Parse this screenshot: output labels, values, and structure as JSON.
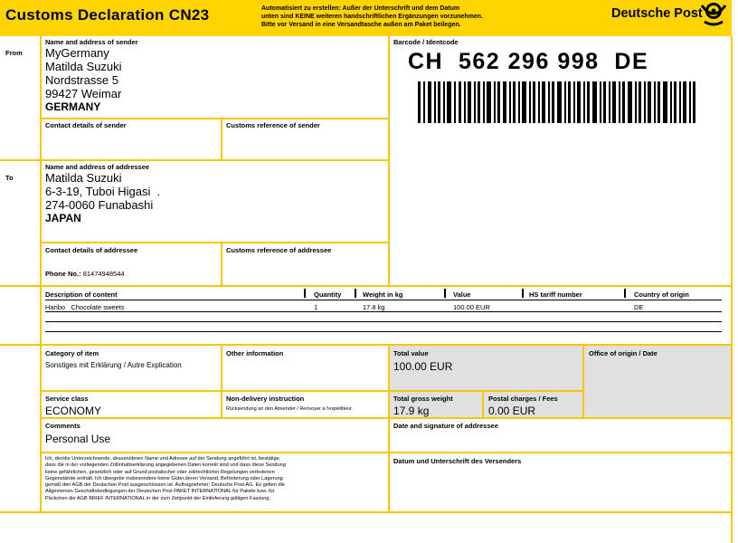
{
  "header": {
    "title": "Customs Declaration CN23",
    "instructions": [
      "Automatisiert zu erstellen: Außer der Unterschrift und dem Datum",
      "unten sind KEINE weiteren handschriftlichen Ergänzungen vorzunehmen.",
      "Bitte vor Versand in eine Versandtasche außen am Paket beilegen."
    ],
    "brand": "Deutsche Post"
  },
  "sender": {
    "row_label": "From",
    "label": "Name and address of sender",
    "lines": [
      "MyGermany",
      "Matilda Suzuki",
      "Nordstrasse 5",
      "99427 Weimar"
    ],
    "country": "GERMANY",
    "contact_label": "Contact details of sender",
    "reference_label": "Customs reference of sender"
  },
  "barcode": {
    "label": "Barcode / Identcode",
    "code": "CH  562 296 998  DE"
  },
  "addressee": {
    "row_label": "To",
    "label": "Name and address of addressee",
    "lines": [
      "Matilda Suzuki",
      "6-3-19, Tuboi Higasi  .",
      "274-0060 Funabashi"
    ],
    "country": "JAPAN",
    "contact_label": "Contact details of addressee",
    "phone_label": "Phone No.:",
    "phone_value": "81474948544",
    "reference_label": "Customs reference of addressee"
  },
  "items": {
    "headers": {
      "description": "Description of content",
      "quantity": "Quantity",
      "weight": "Weight in kg",
      "value": "Value",
      "hs": "HS tariff number",
      "origin": "Country of origin"
    },
    "rows": [
      {
        "description": "Haribo   Chocolate sweets",
        "quantity": "1",
        "weight": "17.8 kg",
        "value": "100.00 EUR",
        "hs": "",
        "origin": "DE"
      }
    ]
  },
  "category": {
    "label": "Category of item",
    "value": "Sonstiges mit Erklärung / Autre Explication",
    "other_label": "Other information"
  },
  "totals": {
    "value_label": "Total value",
    "value": "100.00 EUR",
    "office_label": "Office of origin / Date",
    "weight_label": "Total gross weight",
    "weight": "17.9 kg",
    "postal_label": "Postal charges / Fees",
    "postal": "0.00 EUR"
  },
  "service": {
    "label": "Service class",
    "value": "ECONOMY",
    "nondelivery_label": "Non-delivery instruction",
    "nondelivery_value": "Rücksendung an den Absender / Renvoyer à l'expéditeur"
  },
  "comments": {
    "label": "Comments",
    "value": "Personal Use",
    "addressee_sig_label": "Date and signature of addressee"
  },
  "declaration": {
    "lines": [
      "Ich, der/die Unterzeichnende, dessen/deren Name und Adresse auf der Sendung angeführt ist, bestätige,",
      "dass die in der vorliegenden Zollinhaltserklärung angegebenen Daten korrekt sind und dass diese Sendung",
      "keine gefährlichen, gesetzlich oder auf Grund postalischer oder zollrechtlicher Regelungen verbotenen",
      "Gegenstände enthält. Ich übergebe insbesondere keine Güter,deren Versand, Beförderung oder Lagerung",
      "gemäß den AGB der Deutschen Post ausgeschlossen ist. Auftragnehmer: Deutsche Post AG. Es gelten die",
      "Allgemeinen Geschäftsbedingungen der Deutschen Post PAKET INTERNATIONAL für Pakete bzw. für",
      "Päckchen die AGB BRIEF INTERNATIONAL in der zum Zeitpunkt der Einlieferung gültigen Fassung."
    ],
    "sender_sig_label": "Datum und Unterschrift des Versenders"
  },
  "colors": {
    "brand_yellow": "#ffd400",
    "line_yellow": "#f5c800",
    "grey_cell": "#e0e0e0",
    "brand_red": "#d40511"
  }
}
